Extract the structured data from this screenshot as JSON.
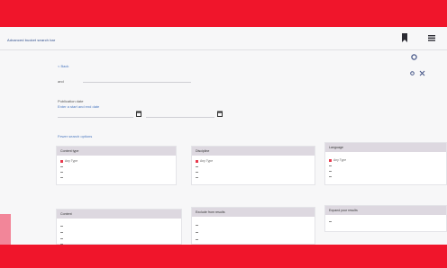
{
  "header": {
    "title": "Advanced bucket search bar"
  },
  "search": {
    "back_link": "< Back",
    "field_label": "and",
    "field_value": "",
    "date_label": "Publication date",
    "date_hint": "Enter a start and end date",
    "start_date": "",
    "end_date": "",
    "fewer_options": "Fewer search options"
  },
  "panels": {
    "content_type": {
      "title": "Content type",
      "action": "",
      "items": [
        "Any Type",
        "",
        "",
        ""
      ]
    },
    "discipline": {
      "title": "Discipline",
      "action": "",
      "items": [
        "Any Type",
        "",
        "",
        ""
      ]
    },
    "language": {
      "title": "Language",
      "action": "",
      "items": [
        "Any Type",
        "",
        "",
        ""
      ]
    },
    "content": {
      "title": "Content",
      "items": [
        "",
        "",
        "",
        ""
      ]
    },
    "exclude": {
      "title": "Exclude from results",
      "items": [
        "",
        "",
        ""
      ]
    },
    "expand": {
      "title": "Expand your results",
      "items": [
        ""
      ]
    }
  },
  "colors": {
    "brand_red": "#f0152b",
    "panel_header": "#ddd8e0",
    "link_blue": "#4a78c0",
    "checked_red": "#e8394d"
  },
  "icons": {
    "bookmark": "bookmark-icon",
    "menu": "menu-icon",
    "settings": "settings-icon",
    "close": "close-icon",
    "calendar": "calendar-icon"
  }
}
